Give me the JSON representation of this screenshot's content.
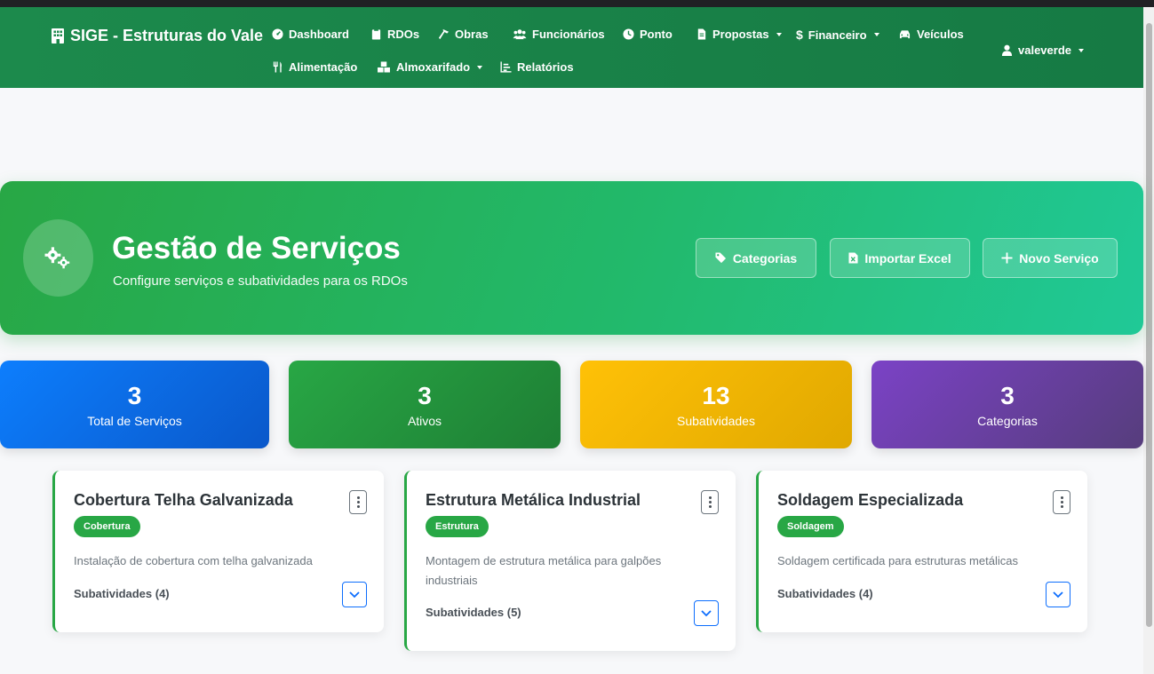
{
  "navbar": {
    "brand": "SIGE - Estruturas do Vale",
    "items": [
      {
        "label": "Dashboard",
        "icon": "dashboard-icon"
      },
      {
        "label": "RDOs",
        "icon": "clipboard-icon"
      },
      {
        "label": "Obras",
        "icon": "hammer-icon"
      },
      {
        "label": "Funcionários",
        "icon": "users-icon"
      },
      {
        "label": "Ponto",
        "icon": "clock-icon"
      },
      {
        "label": "Propostas",
        "icon": "file-icon",
        "dropdown": true
      },
      {
        "label": "Financeiro",
        "icon": "dollar-icon",
        "dropdown": true
      },
      {
        "label": "Veículos",
        "icon": "car-icon"
      },
      {
        "label": "Alimentação",
        "icon": "utensils-icon"
      },
      {
        "label": "Almoxarifado",
        "icon": "boxes-icon",
        "dropdown": true
      },
      {
        "label": "Relatórios",
        "icon": "chart-icon"
      }
    ],
    "user": "valeverde"
  },
  "hero": {
    "title": "Gestão de Serviços",
    "subtitle": "Configure serviços e subatividades para os RDOs",
    "buttons": {
      "categorias": "Categorias",
      "importar": "Importar Excel",
      "novo": "Novo Serviço"
    }
  },
  "stats": [
    {
      "value": "3",
      "label": "Total de Serviços",
      "color": "#0d6efd"
    },
    {
      "value": "3",
      "label": "Ativos",
      "color": "#28a745"
    },
    {
      "value": "13",
      "label": "Subatividades",
      "color": "#ffc107"
    },
    {
      "value": "3",
      "label": "Categorias",
      "color": "#6f42c1"
    }
  ],
  "services": [
    {
      "title": "Cobertura Telha Galvanizada",
      "badge": "Cobertura",
      "description": "Instalação de cobertura com telha galvanizada",
      "subatividades": "Subatividades (4)"
    },
    {
      "title": "Estrutura Metálica Industrial",
      "badge": "Estrutura",
      "description": "Montagem de estrutura metálica para galpões industriais",
      "subatividades": "Subatividades (5)"
    },
    {
      "title": "Soldagem Especializada",
      "badge": "Soldagem",
      "description": "Soldagem certificada para estruturas metálicas",
      "subatividades": "Subatividades (4)"
    }
  ],
  "colors": {
    "primary": "#28a745",
    "navbar": "#1c8a4c",
    "link": "#0d6efd"
  }
}
